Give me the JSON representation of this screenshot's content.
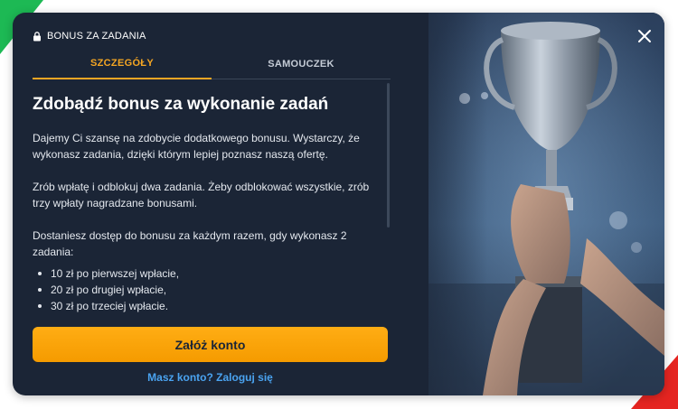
{
  "header": {
    "label": "BONUS ZA ZADANIA"
  },
  "tabs": [
    {
      "label": "SZCZEGÓŁY",
      "active": true
    },
    {
      "label": "SAMOUCZEK",
      "active": false
    }
  ],
  "content": {
    "title": "Zdobądź bonus za wykonanie zadań",
    "paragraphs": [
      "Dajemy Ci szansę na zdobycie dodatkowego bonusu. Wystarczy, że wykonasz zadania, dzięki którym lepiej poznasz naszą ofertę.",
      "Zrób wpłatę i odblokuj dwa zadania. Żeby odblokować wszystkie, zrób trzy wpłaty nagradzane bonusami.",
      "Dostaniesz dostęp do bonusu za każdym razem, gdy wykonasz 2 zadania:"
    ],
    "list": [
      "10 zł po pierwszej wpłacie,",
      "20 zł po drugiej wpłacie,",
      "30 zł po trzeciej wpłacie."
    ]
  },
  "actions": {
    "cta_label": "Załóż konto",
    "login_label": "Masz konto? Zaloguj się"
  },
  "icons": {
    "lock": "lock-icon",
    "close": "close-icon",
    "hero": "trophy-image"
  },
  "colors": {
    "accent": "#f5a623",
    "link": "#4aa3f0",
    "panel": "#1b2536",
    "corner_green": "#1db954",
    "corner_red": "#e52521"
  }
}
